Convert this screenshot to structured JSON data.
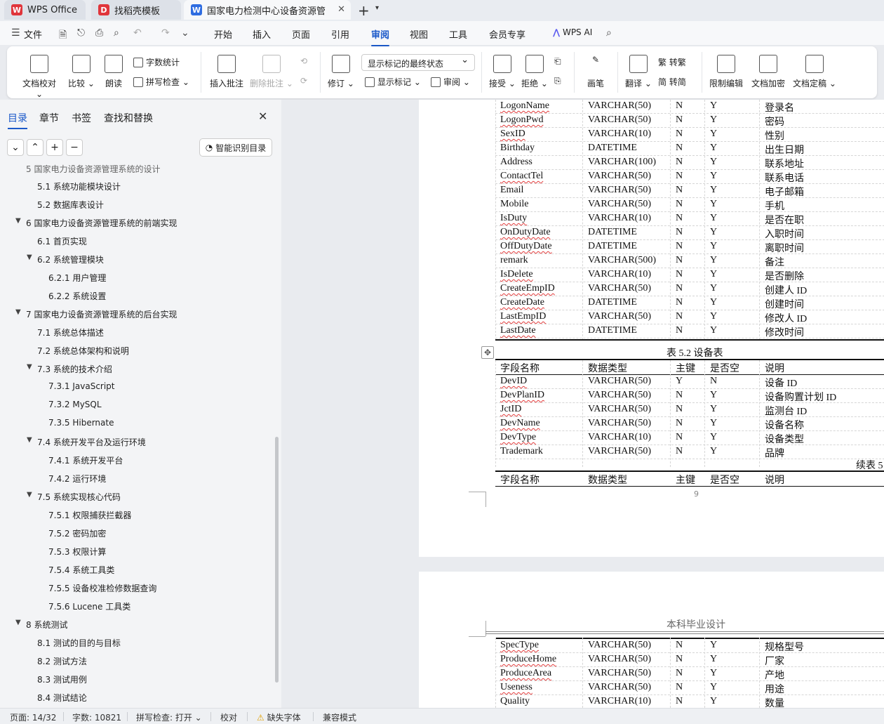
{
  "tabs": {
    "t1": "WPS Office",
    "t2": "找稻壳模板",
    "t3": "国家电力检测中心设备资源管"
  },
  "menu": {
    "file": "文件",
    "start": "开始",
    "insert": "插入",
    "page": "页面",
    "ref": "引用",
    "review": "审阅",
    "view": "视图",
    "tools": "工具",
    "vip": "会员专享",
    "ai": "WPS AI"
  },
  "ribbon": {
    "proof": "文档校对",
    "compare": "比较",
    "read": "朗读",
    "wordcount": "字数统计",
    "spell": "拼写检查",
    "insert_comment": "插入批注",
    "delete_comment": "删除批注",
    "revise": "修订",
    "display_state": "显示标记的最终状态",
    "show_marks": "显示标记",
    "review_pane": "审阅",
    "accept": "接受",
    "reject": "拒绝",
    "pen": "画笔",
    "translate": "翻译",
    "to_trad": "转繁",
    "to_simp": "转简",
    "restrict": "限制编辑",
    "encrypt": "文档加密",
    "finalize": "文档定稿"
  },
  "sidebar": {
    "tab_toc": "目录",
    "tab_chapter": "章节",
    "tab_bookmark": "书签",
    "tab_find": "查找和替换",
    "smart_toc": "智能识别目录",
    "toc": [
      "5  国家电力设备资源管理系统的设计",
      "5.1  系统功能模块设计",
      "5.2  数据库表设计",
      "6  国家电力设备资源管理系统的前端实现",
      "6.1  首页实现",
      "6.2  系统管理模块",
      "6.2.1  用户管理",
      "6.2.2  系统设置",
      "7  国家电力设备资源管理系统的后台实现",
      "7.1  系统总体描述",
      "7.2  系统总体架构和说明",
      "7.3  系统的技术介绍",
      "7.3.1 JavaScript",
      "7.3.2 MySQL",
      "7.3.5 Hibernate",
      "7.4  系统开发平台及运行环境",
      "7.4.1  系统开发平台",
      "7.4.2  运行环境",
      "7.5  系统实现核心代码",
      "7.5.1  权限捕获拦截器",
      "7.5.2  密码加密",
      "7.5.3  权限计算",
      "7.5.4  系统工具类",
      "7.5.5  设备校准检修数据查询",
      "7.5.6 Lucene 工具类",
      "8  系统测试",
      "8.1  测试的目的与目标",
      "8.2  测试方法",
      "8.3  测试用例",
      "8.4  测试结论"
    ]
  },
  "doc": {
    "table1_rows": [
      [
        "LogonName",
        "VARCHAR(50)",
        "N",
        "Y",
        "登录名"
      ],
      [
        "LogonPwd",
        "VARCHAR(50)",
        "N",
        "Y",
        "密码"
      ],
      [
        "SexID",
        "VARCHAR(10)",
        "N",
        "Y",
        "性别"
      ],
      [
        "Birthday",
        "DATETIME",
        "N",
        "Y",
        "出生日期"
      ],
      [
        "Address",
        "VARCHAR(100)",
        "N",
        "Y",
        "联系地址"
      ],
      [
        "ContactTel",
        "VARCHAR(50)",
        "N",
        "Y",
        "联系电话"
      ],
      [
        "Email",
        "VARCHAR(50)",
        "N",
        "Y",
        "电子邮箱"
      ],
      [
        "Mobile",
        "VARCHAR(50)",
        "N",
        "Y",
        "手机"
      ],
      [
        "IsDuty",
        "VARCHAR(10)",
        "N",
        "Y",
        "是否在职"
      ],
      [
        "OnDutyDate",
        "DATETIME",
        "N",
        "Y",
        "入职时间"
      ],
      [
        "OffDutyDate",
        "DATETIME",
        "N",
        "Y",
        "离职时间"
      ],
      [
        "remark",
        "VARCHAR(500)",
        "N",
        "Y",
        "备注"
      ],
      [
        "IsDelete",
        "VARCHAR(10)",
        "N",
        "Y",
        "是否删除"
      ],
      [
        "CreateEmpID",
        "VARCHAR(50)",
        "N",
        "Y",
        "创建人 ID"
      ],
      [
        "CreateDate",
        "DATETIME",
        "N",
        "Y",
        "创建时间"
      ],
      [
        "LastEmpID",
        "VARCHAR(50)",
        "N",
        "Y",
        "修改人 ID"
      ],
      [
        "LastDate",
        "DATETIME",
        "N",
        "Y",
        "修改时间"
      ]
    ],
    "caption2": "表 5.2  设备表",
    "header": [
      "字段名称",
      "数据类型",
      "主键",
      "是否空",
      "说明"
    ],
    "table2_rows": [
      [
        "DevID",
        "VARCHAR(50)",
        "Y",
        "N",
        "设备 ID"
      ],
      [
        "DevPlanID",
        "VARCHAR(50)",
        "N",
        "Y",
        "设备购置计划 ID"
      ],
      [
        "JctID",
        "VARCHAR(50)",
        "N",
        "Y",
        "监测台 ID"
      ],
      [
        "DevName",
        "VARCHAR(50)",
        "N",
        "Y",
        "设备名称"
      ],
      [
        "DevType",
        "VARCHAR(10)",
        "N",
        "Y",
        "设备类型"
      ],
      [
        "Trademark",
        "VARCHAR(50)",
        "N",
        "Y",
        "品牌"
      ]
    ],
    "continued": "续表  5",
    "page_number": "9",
    "page_header": "本科毕业设计",
    "table3_rows": [
      [
        "SpecType",
        "VARCHAR(50)",
        "N",
        "Y",
        "规格型号"
      ],
      [
        "ProduceHome",
        "VARCHAR(50)",
        "N",
        "Y",
        "厂家"
      ],
      [
        "ProduceArea",
        "VARCHAR(50)",
        "N",
        "Y",
        "产地"
      ],
      [
        "Useness",
        "VARCHAR(50)",
        "N",
        "Y",
        "用途"
      ],
      [
        "Quality",
        "VARCHAR(10)",
        "N",
        "Y",
        "数量"
      ]
    ]
  },
  "status": {
    "page": "页面: 14/32",
    "words": "字数: 10821",
    "spell": "拼写检查: 打开",
    "proof": "校对",
    "missing_font": "缺失字体",
    "compat": "兼容模式"
  }
}
